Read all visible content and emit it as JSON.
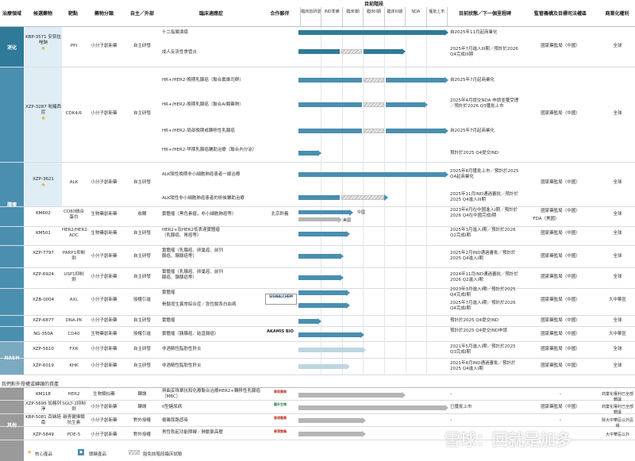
{
  "header": {
    "area": "治療領域",
    "candidate": "候選藥物",
    "target": "靶點",
    "category": "藥物分類",
    "origin": "自主／外部",
    "indication": "臨床適應症",
    "partner": "合作夥伴",
    "stage_title": "目前階段",
    "stages": [
      "臨床前研發",
      "IND準備",
      "臨床I期",
      "臨床II期",
      "臨床III期",
      "NDA",
      "獲批上市"
    ],
    "status": "目前狀態／下一個里程碑",
    "regulator": "監管機構及目標司法權區",
    "rights": "商業化權利"
  },
  "areas": {
    "digestion": "消化",
    "oncology": "腫瘤",
    "nash": "NASH",
    "other": "其他"
  },
  "rows": {
    "kbp3571": {
      "candidate": "KBP-3571 安奈拉唑鈉",
      "target": "PPI",
      "category": "小分子創新藥",
      "origin": "自主研發",
      "ind1": "十二指腸潰瘍",
      "ind2": "成人反流性食管炎",
      "status1": "自2025年11月起商業化",
      "status2": "2025年7月進入III期／預計於2026 Q4完成III期",
      "regulator": "國家藥監局（中國）",
      "rights": "全球"
    },
    "xzp3287": {
      "candidate": "XZP-3287 吡羅西尼",
      "target": "CDK4/6",
      "category": "小分子創新藥",
      "origin": "自主研發",
      "ind1": "HR+/HER2-晚期乳腺癌（聯合氟維司群）",
      "ind2": "HR+/HER2-晚期乳腺癌（聯合AI類藥物）",
      "ind3": "HR+/HER2-局部晚期或轉移性乳腺癌",
      "ind4": "HR+/HER2-早期乳腺癌輔助治療（聯合內分泌）",
      "status1": "自2025年7月起商業化",
      "status2": "2025年4月提交NDA 申請並獲受理／預計於2026 Q3獲批上市",
      "status3": "自2025年7月起商業化",
      "status4": "預計於2025 Q4提交IND",
      "regulator": "國家藥監局（中國）",
      "rights": "全球"
    },
    "xzp3621": {
      "candidate": "XZP-3621",
      "target": "ALK",
      "category": "小分子創新藥",
      "origin": "自主研發",
      "ind1": "ALK陽性晚期非小細胞肺癌患者一線治療",
      "ind2": "ALK陽性非小細胞肺癌患者的術後輔助治療",
      "status1": "2025年8月獲批上市／預計於2025 Q4起商業化",
      "status2": "2025年11月IND通過審批／預計於2025 Q4進入III期",
      "regulator": "國家藥監局（中國）",
      "rights": "全球"
    },
    "km602": {
      "candidate": "KM602",
      "target": "CD80融合蛋白",
      "category": "生物藥創新藥",
      "origin": "收購",
      "ind": "實體瘤（黑色素瘤，非小細胞肺癌等）",
      "partner": "北京軒義",
      "label_cn": "中國",
      "label_us": "美國",
      "status": "2023年4月在中國進入I期／預計於2026 Q4在中國完成I期",
      "regulator": "國家藥監局（中國）",
      "regulator2": "FDA（美國）",
      "rights": "全球"
    },
    "km501": {
      "candidate": "KM501",
      "target": "HER2/HER2-ADC",
      "category": "生物藥創新藥",
      "origin": "自主研發",
      "ind": "HER2+及HER2低表達實體瘤（乳腺癌、胃癌等）",
      "status": "2025年3月進入I期／預計於2026 Q2完成I期",
      "regulator": "國家藥監局（中國）",
      "rights": "全球"
    },
    "xzp7797": {
      "candidate": "XZP-7797",
      "target": "PARP1抑制劑",
      "category": "小分子創新藥",
      "origin": "自主研發",
      "ind": "實體瘤（乳腺癌、卵巢癌、前列腺癌、胰腺癌等）",
      "status": "2025年2月IND通過審批／預計於2025 Q4進入I期",
      "regulator": "國家藥監局（中國）",
      "rights": "全球"
    },
    "xzp6924": {
      "candidate": "XZP-6924",
      "target": "USP1抑制劑",
      "category": "小分子創新藥",
      "origin": "自主研發",
      "ind": "實體瘤（乳腺癌、卵巢癌、前列腺癌、胰腺癌等）",
      "status": "2024年11月IND通過審批／預計於2026 Q2進入I期",
      "regulator": "國家藥監局（中國）",
      "rights": "全球"
    },
    "xzb0004": {
      "candidate": "XZB-0004",
      "target": "AXL",
      "category": "小分子創新藥",
      "origin": "授權引進",
      "ind1": "實體瘤",
      "ind2": "骨髓增生異常綜合症／急性髓系白血病",
      "status1": "2023年3月進入I期／預計於2025 Q4完成I期",
      "status2": "2025年7月進入I期／預計於2026 Q4完成I期",
      "regulator": "國家藥監局（中國）",
      "rights": "大中華區"
    },
    "xzp6877": {
      "candidate": "XZP-6877",
      "target": "DNA-PK",
      "category": "小分子創新藥",
      "origin": "自主研發",
      "ind": "實體瘤",
      "status": "預計於2025 Q4提交IND",
      "regulator": "國家藥監局（中國）",
      "rights": "全球"
    },
    "ng350a": {
      "candidate": "NG-350A",
      "target": "CD40",
      "category": "生物藥創新藥",
      "origin": "授權引進",
      "ind": "實體瘤（胰腺癌、結直腸癌）",
      "status": "預計於2025 Q4提交IND申請",
      "regulator": "國家藥監局（中國）",
      "rights": "大中華區"
    },
    "xzp5610": {
      "candidate": "XZP-5610",
      "target": "FXR",
      "category": "小分子創新藥",
      "origin": "自主研發",
      "ind": "非酒精性脂肪性肝炎",
      "status": "2021年5月進入I期／預計於2025 Q3完成I期",
      "regulator": "國家藥監局（中國）",
      "rights": "全球"
    },
    "xzp6019": {
      "candidate": "XZP-6019",
      "target": "KHK",
      "category": "小分子創新藥",
      "origin": "自主研發",
      "ind": "非酒精性脂肪性肝炎",
      "status": "2021年8月IND通過審批／預計於2025 Q4進入I期",
      "regulator": "國家藥監局（中國）",
      "rights": "全球"
    }
  },
  "outlicense_title": "我們對外授權或轉讓的資產",
  "other_rows": {
    "km118": {
      "candidate": "KM118",
      "target": "HER2",
      "category": "生物類似藥",
      "origin": "轉讓",
      "ind": "與曲妥珠單抗和化療聯合治療HER2+轉移性乳腺癌（MBC）",
      "status": "–",
      "regulator": "–",
      "rights": "商業化權利已全部轉讓"
    },
    "xzp5695": {
      "candidate": "XZP-5695 加格列淨",
      "target": "SGLT-2抑制劑",
      "category": "小分子創新藥",
      "origin": "轉讓",
      "ind": "II型糖尿病",
      "status": "已獲批上市",
      "regulator": "國家藥監局（中國）",
      "rights": "商業化權利已全部轉讓"
    },
    "kbp5081": {
      "candidate": "KBP-5081 百納培南",
      "target": "碳青黴烯類抗生素",
      "category": "小分子創新藥",
      "origin": "對外授權",
      "ind": "複雜尿路感染",
      "status": "–",
      "regulator": "–",
      "rights": "除大中華區以外區域"
    },
    "xzp5849": {
      "candidate": "XZP-5849",
      "target": "PDE-5",
      "category": "小分子創新藥",
      "origin": "對外授權",
      "ind": "男性勃起功能障礙／肺動脈高壓",
      "status": "–",
      "regulator": "–",
      "rights": "大中華區以外"
    }
  },
  "partners": {
    "signalchem": "SIGNALCHEM",
    "akamis": "AKAMIS BIO",
    "p1": "華東藥業",
    "p2": "惠升生物",
    "p3": "慧源醫藥",
    "p4": "華潤雙鶴"
  },
  "legend": {
    "core": "核心產品",
    "key": "關鍵產品",
    "exempt": "豁免該階段臨床試驗"
  },
  "watermark": "雪球：回就是加多"
}
